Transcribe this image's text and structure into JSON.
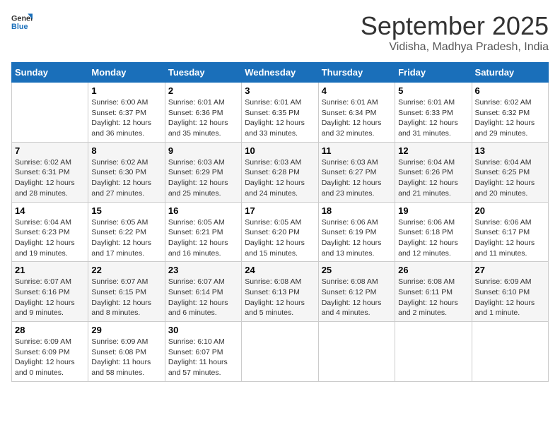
{
  "header": {
    "logo_text_general": "General",
    "logo_text_blue": "Blue",
    "month_title": "September 2025",
    "subtitle": "Vidisha, Madhya Pradesh, India"
  },
  "weekdays": [
    "Sunday",
    "Monday",
    "Tuesday",
    "Wednesday",
    "Thursday",
    "Friday",
    "Saturday"
  ],
  "weeks": [
    [
      {
        "day": "",
        "info": ""
      },
      {
        "day": "1",
        "info": "Sunrise: 6:00 AM\nSunset: 6:37 PM\nDaylight: 12 hours\nand 36 minutes."
      },
      {
        "day": "2",
        "info": "Sunrise: 6:01 AM\nSunset: 6:36 PM\nDaylight: 12 hours\nand 35 minutes."
      },
      {
        "day": "3",
        "info": "Sunrise: 6:01 AM\nSunset: 6:35 PM\nDaylight: 12 hours\nand 33 minutes."
      },
      {
        "day": "4",
        "info": "Sunrise: 6:01 AM\nSunset: 6:34 PM\nDaylight: 12 hours\nand 32 minutes."
      },
      {
        "day": "5",
        "info": "Sunrise: 6:01 AM\nSunset: 6:33 PM\nDaylight: 12 hours\nand 31 minutes."
      },
      {
        "day": "6",
        "info": "Sunrise: 6:02 AM\nSunset: 6:32 PM\nDaylight: 12 hours\nand 29 minutes."
      }
    ],
    [
      {
        "day": "7",
        "info": "Sunrise: 6:02 AM\nSunset: 6:31 PM\nDaylight: 12 hours\nand 28 minutes."
      },
      {
        "day": "8",
        "info": "Sunrise: 6:02 AM\nSunset: 6:30 PM\nDaylight: 12 hours\nand 27 minutes."
      },
      {
        "day": "9",
        "info": "Sunrise: 6:03 AM\nSunset: 6:29 PM\nDaylight: 12 hours\nand 25 minutes."
      },
      {
        "day": "10",
        "info": "Sunrise: 6:03 AM\nSunset: 6:28 PM\nDaylight: 12 hours\nand 24 minutes."
      },
      {
        "day": "11",
        "info": "Sunrise: 6:03 AM\nSunset: 6:27 PM\nDaylight: 12 hours\nand 23 minutes."
      },
      {
        "day": "12",
        "info": "Sunrise: 6:04 AM\nSunset: 6:26 PM\nDaylight: 12 hours\nand 21 minutes."
      },
      {
        "day": "13",
        "info": "Sunrise: 6:04 AM\nSunset: 6:25 PM\nDaylight: 12 hours\nand 20 minutes."
      }
    ],
    [
      {
        "day": "14",
        "info": "Sunrise: 6:04 AM\nSunset: 6:23 PM\nDaylight: 12 hours\nand 19 minutes."
      },
      {
        "day": "15",
        "info": "Sunrise: 6:05 AM\nSunset: 6:22 PM\nDaylight: 12 hours\nand 17 minutes."
      },
      {
        "day": "16",
        "info": "Sunrise: 6:05 AM\nSunset: 6:21 PM\nDaylight: 12 hours\nand 16 minutes."
      },
      {
        "day": "17",
        "info": "Sunrise: 6:05 AM\nSunset: 6:20 PM\nDaylight: 12 hours\nand 15 minutes."
      },
      {
        "day": "18",
        "info": "Sunrise: 6:06 AM\nSunset: 6:19 PM\nDaylight: 12 hours\nand 13 minutes."
      },
      {
        "day": "19",
        "info": "Sunrise: 6:06 AM\nSunset: 6:18 PM\nDaylight: 12 hours\nand 12 minutes."
      },
      {
        "day": "20",
        "info": "Sunrise: 6:06 AM\nSunset: 6:17 PM\nDaylight: 12 hours\nand 11 minutes."
      }
    ],
    [
      {
        "day": "21",
        "info": "Sunrise: 6:07 AM\nSunset: 6:16 PM\nDaylight: 12 hours\nand 9 minutes."
      },
      {
        "day": "22",
        "info": "Sunrise: 6:07 AM\nSunset: 6:15 PM\nDaylight: 12 hours\nand 8 minutes."
      },
      {
        "day": "23",
        "info": "Sunrise: 6:07 AM\nSunset: 6:14 PM\nDaylight: 12 hours\nand 6 minutes."
      },
      {
        "day": "24",
        "info": "Sunrise: 6:08 AM\nSunset: 6:13 PM\nDaylight: 12 hours\nand 5 minutes."
      },
      {
        "day": "25",
        "info": "Sunrise: 6:08 AM\nSunset: 6:12 PM\nDaylight: 12 hours\nand 4 minutes."
      },
      {
        "day": "26",
        "info": "Sunrise: 6:08 AM\nSunset: 6:11 PM\nDaylight: 12 hours\nand 2 minutes."
      },
      {
        "day": "27",
        "info": "Sunrise: 6:09 AM\nSunset: 6:10 PM\nDaylight: 12 hours\nand 1 minute."
      }
    ],
    [
      {
        "day": "28",
        "info": "Sunrise: 6:09 AM\nSunset: 6:09 PM\nDaylight: 12 hours\nand 0 minutes."
      },
      {
        "day": "29",
        "info": "Sunrise: 6:09 AM\nSunset: 6:08 PM\nDaylight: 11 hours\nand 58 minutes."
      },
      {
        "day": "30",
        "info": "Sunrise: 6:10 AM\nSunset: 6:07 PM\nDaylight: 11 hours\nand 57 minutes."
      },
      {
        "day": "",
        "info": ""
      },
      {
        "day": "",
        "info": ""
      },
      {
        "day": "",
        "info": ""
      },
      {
        "day": "",
        "info": ""
      }
    ]
  ]
}
